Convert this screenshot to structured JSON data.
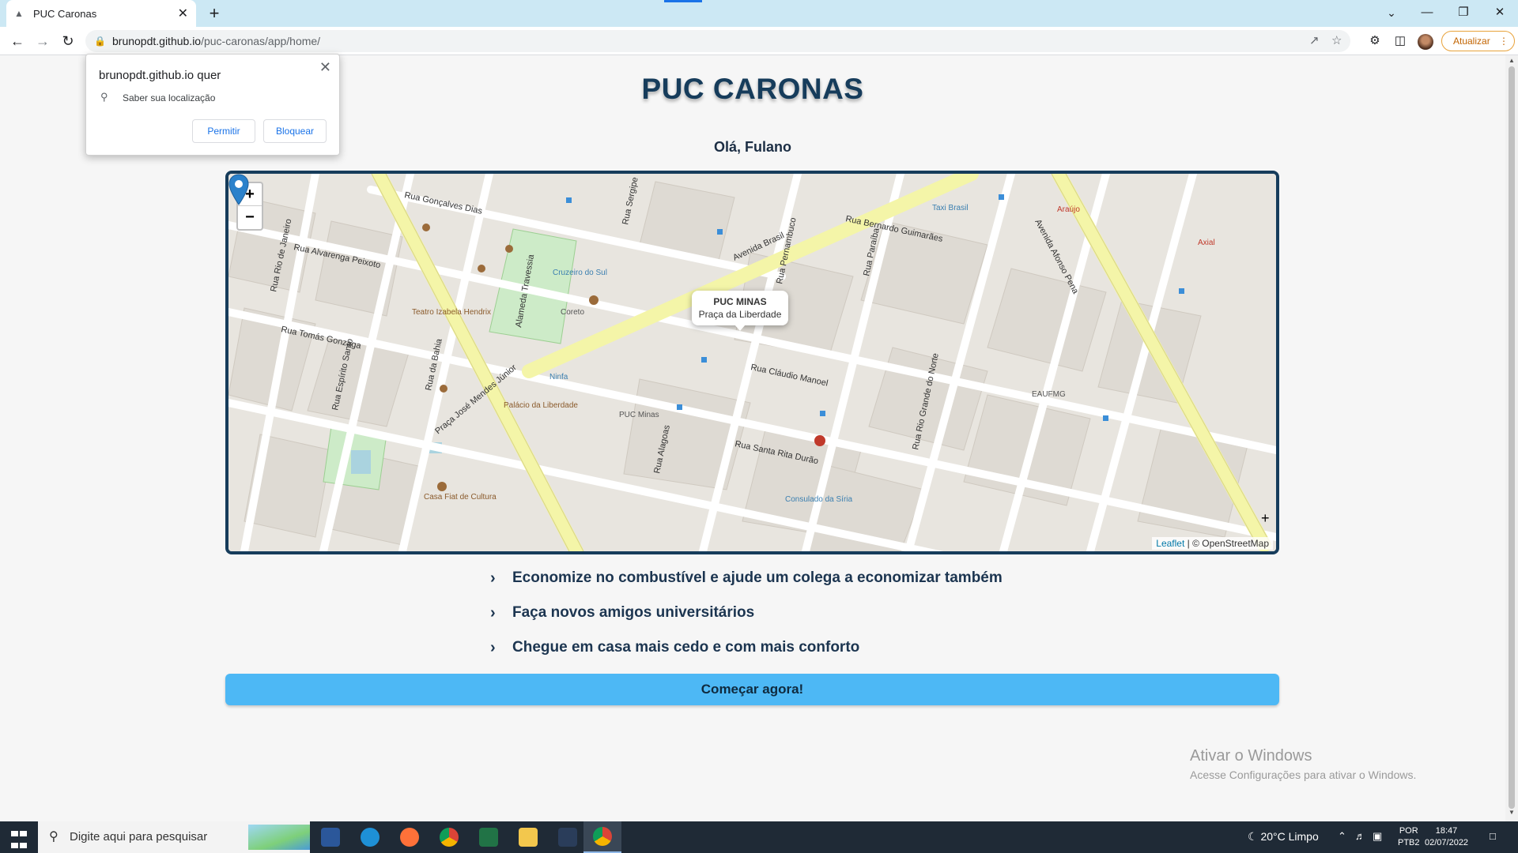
{
  "browser": {
    "tab_title": "PUC Caronas",
    "url_host": "brunopdt.github.io",
    "url_path": "/puc-caronas/app/home/",
    "update_label": "Atualizar"
  },
  "permission_prompt": {
    "heading": "brunopdt.github.io quer",
    "request": "Saber sua localização",
    "allow_label": "Permitir",
    "block_label": "Bloquear"
  },
  "page": {
    "title": "PUC CARONAS",
    "greeting": "Olá, Fulano",
    "map": {
      "zoom_in": "+",
      "zoom_out": "−",
      "popup_title": "PUC MINAS",
      "popup_subtitle": "Praça da Liberdade",
      "attribution_leaflet": "Leaflet",
      "attribution_osm": "© OpenStreetMap",
      "street_labels": [
        "Rua Gonçalves Dias",
        "Rua Alvarenga Peixoto",
        "Rua Tomás Gonzaga",
        "Avenida Brasil",
        "Rua Bernardo Guimarães",
        "Rua Cláudio Manoel",
        "Rua Santa Rita Durão",
        "Alameda Travessia",
        "Rua Sergipe",
        "Rua Pernambuco",
        "Rua Paraíba",
        "Avenida Afonso Pena",
        "Rua Rio de Janeiro",
        "Rua Espírito Santo",
        "Rua da Bahia",
        "Praça José Mendes Júnior",
        "Rua Alagoas",
        "Rua Rio Grande do Norte"
      ],
      "poi_labels": [
        "Teatro Izabela Hendrix",
        "Palácio da Liberdade",
        "Casa Fiat de Cultura",
        "Cruzeiro do Sul",
        "Coreto",
        "Ninfa",
        "PUC Minas",
        "Consulado da Síria",
        "Taxi Brasil",
        "Araújo",
        "Axial",
        "EAUFMG"
      ]
    },
    "features": [
      "Economize no combustível e ajude um colega a economizar também",
      "Faça novos amigos universitários",
      "Chegue em casa mais cedo e com mais conforto"
    ],
    "cta_label": "Começar agora!",
    "activation_title": "Ativar o Windows",
    "activation_subtitle": "Acesse Configurações para ativar o Windows."
  },
  "taskbar": {
    "search_placeholder": "Digite aqui para pesquisar",
    "weather": "20°C  Limpo",
    "lang_line1": "POR",
    "lang_line2": "PTB2",
    "time": "18:47",
    "date": "02/07/2022"
  },
  "colors": {
    "brand_dark": "#163c5b",
    "cta": "#4db8f5",
    "marker": "#2a81cb"
  },
  "icons": {
    "back": "arrow-left-icon",
    "forward": "arrow-right-icon",
    "reload": "reload-icon",
    "lock": "lock-icon",
    "location": "location-pin-icon"
  }
}
